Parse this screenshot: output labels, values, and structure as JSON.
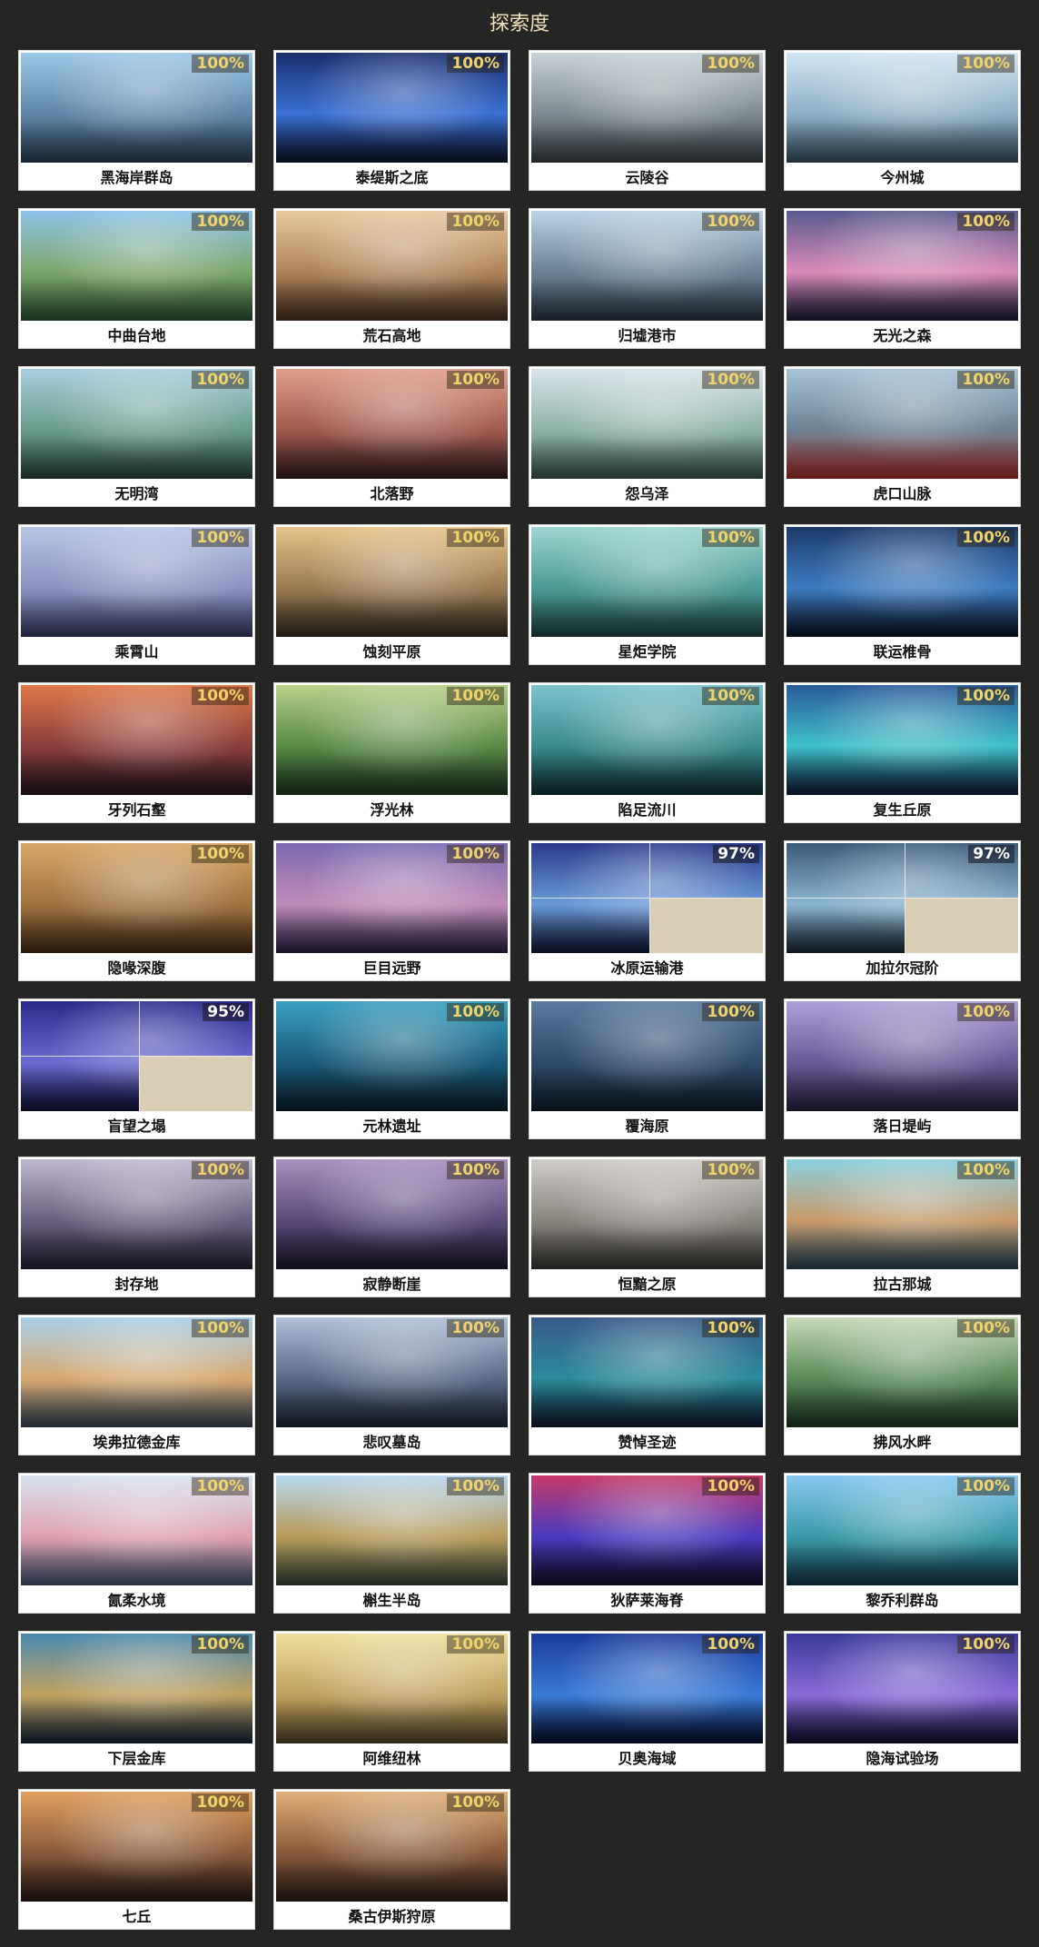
{
  "title": "探索度",
  "regions": [
    {
      "name": "黑海岸群岛",
      "progress": "100%",
      "tone": [
        "#9ec9e8",
        "#5f86a8",
        "#2c4259"
      ]
    },
    {
      "name": "泰缇斯之底",
      "progress": "100%",
      "tone": [
        "#1b2f6e",
        "#3a6fd4",
        "#0d1530"
      ]
    },
    {
      "name": "云陵谷",
      "progress": "100%",
      "tone": [
        "#c9d3d8",
        "#7f8c93",
        "#3c4449"
      ]
    },
    {
      "name": "今州城",
      "progress": "100%",
      "tone": [
        "#d2e6f3",
        "#8fb0c6",
        "#3a5568"
      ]
    },
    {
      "name": "中曲台地",
      "progress": "100%",
      "tone": [
        "#8ec3ea",
        "#7da66a",
        "#2f5a36"
      ]
    },
    {
      "name": "荒石高地",
      "progress": "100%",
      "tone": [
        "#e8c9a0",
        "#b0845a",
        "#4a3322"
      ]
    },
    {
      "name": "归墟港市",
      "progress": "100%",
      "tone": [
        "#bcd4e8",
        "#6b8296",
        "#2c3a48"
      ]
    },
    {
      "name": "无光之森",
      "progress": "100%",
      "tone": [
        "#5a5a8e",
        "#d98ab8",
        "#1c1c3a"
      ]
    },
    {
      "name": "无明湾",
      "progress": "100%",
      "tone": [
        "#a8cfe0",
        "#6a9c8a",
        "#2b4a44"
      ]
    },
    {
      "name": "北落野",
      "progress": "100%",
      "tone": [
        "#e0a08a",
        "#a05a4e",
        "#3a1f22"
      ]
    },
    {
      "name": "怨乌泽",
      "progress": "100%",
      "tone": [
        "#d8e4ea",
        "#8fb3a8",
        "#3d5b52"
      ]
    },
    {
      "name": "虎口山脉",
      "progress": "100%",
      "tone": [
        "#a8c4d8",
        "#6b8294",
        "#b0302c"
      ]
    },
    {
      "name": "乘霄山",
      "progress": "100%",
      "tone": [
        "#b8c6e6",
        "#8a92c0",
        "#3c3f6a"
      ]
    },
    {
      "name": "蚀刻平原",
      "progress": "100%",
      "tone": [
        "#e8c48a",
        "#9a7a52",
        "#3a3022"
      ]
    },
    {
      "name": "星炬学院",
      "progress": "100%",
      "tone": [
        "#9ed6d2",
        "#4e9a94",
        "#1e4a48"
      ]
    },
    {
      "name": "联运椎骨",
      "progress": "100%",
      "tone": [
        "#1c3a6a",
        "#3e7cc0",
        "#0a1428"
      ]
    },
    {
      "name": "牙列石壑",
      "progress": "100%",
      "tone": [
        "#e0784a",
        "#8a3e3a",
        "#2a1622"
      ]
    },
    {
      "name": "浮光林",
      "progress": "100%",
      "tone": [
        "#b8d08a",
        "#5a8a46",
        "#1e3a22"
      ]
    },
    {
      "name": "陷足流川",
      "progress": "100%",
      "tone": [
        "#7ec4d0",
        "#3a8a8c",
        "#10343a"
      ]
    },
    {
      "name": "复生丘原",
      "progress": "100%",
      "tone": [
        "#2a5a9a",
        "#3ec0c8",
        "#0c1a3a"
      ]
    },
    {
      "name": "隐喙深腹",
      "progress": "100%",
      "tone": [
        "#d8a86a",
        "#a07240",
        "#4a3018"
      ]
    },
    {
      "name": "巨目远野",
      "progress": "100%",
      "tone": [
        "#7a6ab0",
        "#c08ab8",
        "#2a2448"
      ]
    },
    {
      "name": "冰原运输港",
      "progress": "97%",
      "tone": [
        "#2a3a8a",
        "#6a9ad8",
        "#10183a"
      ],
      "partial": true
    },
    {
      "name": "加拉尔冠阶",
      "progress": "97%",
      "tone": [
        "#3a5a7a",
        "#8ab4d0",
        "#1a2a3a"
      ],
      "partial": true
    },
    {
      "name": "盲望之塌",
      "progress": "95%",
      "tone": [
        "#2a2a8a",
        "#6a6ad0",
        "#101040"
      ],
      "partial": true
    },
    {
      "name": "元林遗址",
      "progress": "100%",
      "tone": [
        "#3aa0c0",
        "#1a5a7a",
        "#0a2230"
      ]
    },
    {
      "name": "覆海原",
      "progress": "100%",
      "tone": [
        "#5a7aa0",
        "#2e4a6a",
        "#10202e"
      ]
    },
    {
      "name": "落日堤屿",
      "progress": "100%",
      "tone": [
        "#b0a0d8",
        "#6a5a98",
        "#2a2240"
      ]
    },
    {
      "name": "封存地",
      "progress": "100%",
      "tone": [
        "#c0b8d0",
        "#6a6080",
        "#28243a"
      ]
    },
    {
      "name": "寂静断崖",
      "progress": "100%",
      "tone": [
        "#a890c0",
        "#5a4a7a",
        "#1e1830"
      ]
    },
    {
      "name": "恒黯之原",
      "progress": "100%",
      "tone": [
        "#d0ccc8",
        "#8a8680",
        "#3a3834"
      ]
    },
    {
      "name": "拉古那城",
      "progress": "100%",
      "tone": [
        "#8ad0e0",
        "#c89a6a",
        "#2a4a5a"
      ]
    },
    {
      "name": "埃弗拉德金库",
      "progress": "100%",
      "tone": [
        "#a8d0ea",
        "#d8a870",
        "#3a4a5a"
      ]
    },
    {
      "name": "悲叹墓岛",
      "progress": "100%",
      "tone": [
        "#b0c0d8",
        "#5a6a88",
        "#1e2838"
      ]
    },
    {
      "name": "赞悼圣迹",
      "progress": "100%",
      "tone": [
        "#3a5a8a",
        "#2a8a9a",
        "#101a2e"
      ]
    },
    {
      "name": "拂风水畔",
      "progress": "100%",
      "tone": [
        "#c8dab8",
        "#5a8a5a",
        "#1e3a24"
      ]
    },
    {
      "name": "氤柔水境",
      "progress": "100%",
      "tone": [
        "#d8e4f0",
        "#e0a0b0",
        "#4a5a78"
      ]
    },
    {
      "name": "槲生半岛",
      "progress": "100%",
      "tone": [
        "#b8d8f0",
        "#b89a5a",
        "#3a4a3a"
      ]
    },
    {
      "name": "狄萨莱海脊",
      "progress": "100%",
      "tone": [
        "#c83a6a",
        "#4a3ac0",
        "#14102e"
      ]
    },
    {
      "name": "黎乔利群岛",
      "progress": "100%",
      "tone": [
        "#8ac8f0",
        "#3a9aa8",
        "#14384a"
      ]
    },
    {
      "name": "下层金库",
      "progress": "100%",
      "tone": [
        "#4a8ab0",
        "#c0a060",
        "#14283a"
      ]
    },
    {
      "name": "阿维纽林",
      "progress": "100%",
      "tone": [
        "#f0e0a0",
        "#c0a060",
        "#5a4a2a"
      ]
    },
    {
      "name": "贝奥海域",
      "progress": "100%",
      "tone": [
        "#1a3a9a",
        "#3a7ad8",
        "#060e30"
      ]
    },
    {
      "name": "隐海试验场",
      "progress": "100%",
      "tone": [
        "#3a3a9a",
        "#8a6ad8",
        "#0e0e30"
      ]
    },
    {
      "name": "七丘",
      "progress": "100%",
      "tone": [
        "#e0a060",
        "#8a5a3a",
        "#2a1a14"
      ]
    },
    {
      "name": "桑古伊斯狩原",
      "progress": "100%",
      "tone": [
        "#e0b07a",
        "#8a5a3a",
        "#2e1e18"
      ]
    }
  ]
}
